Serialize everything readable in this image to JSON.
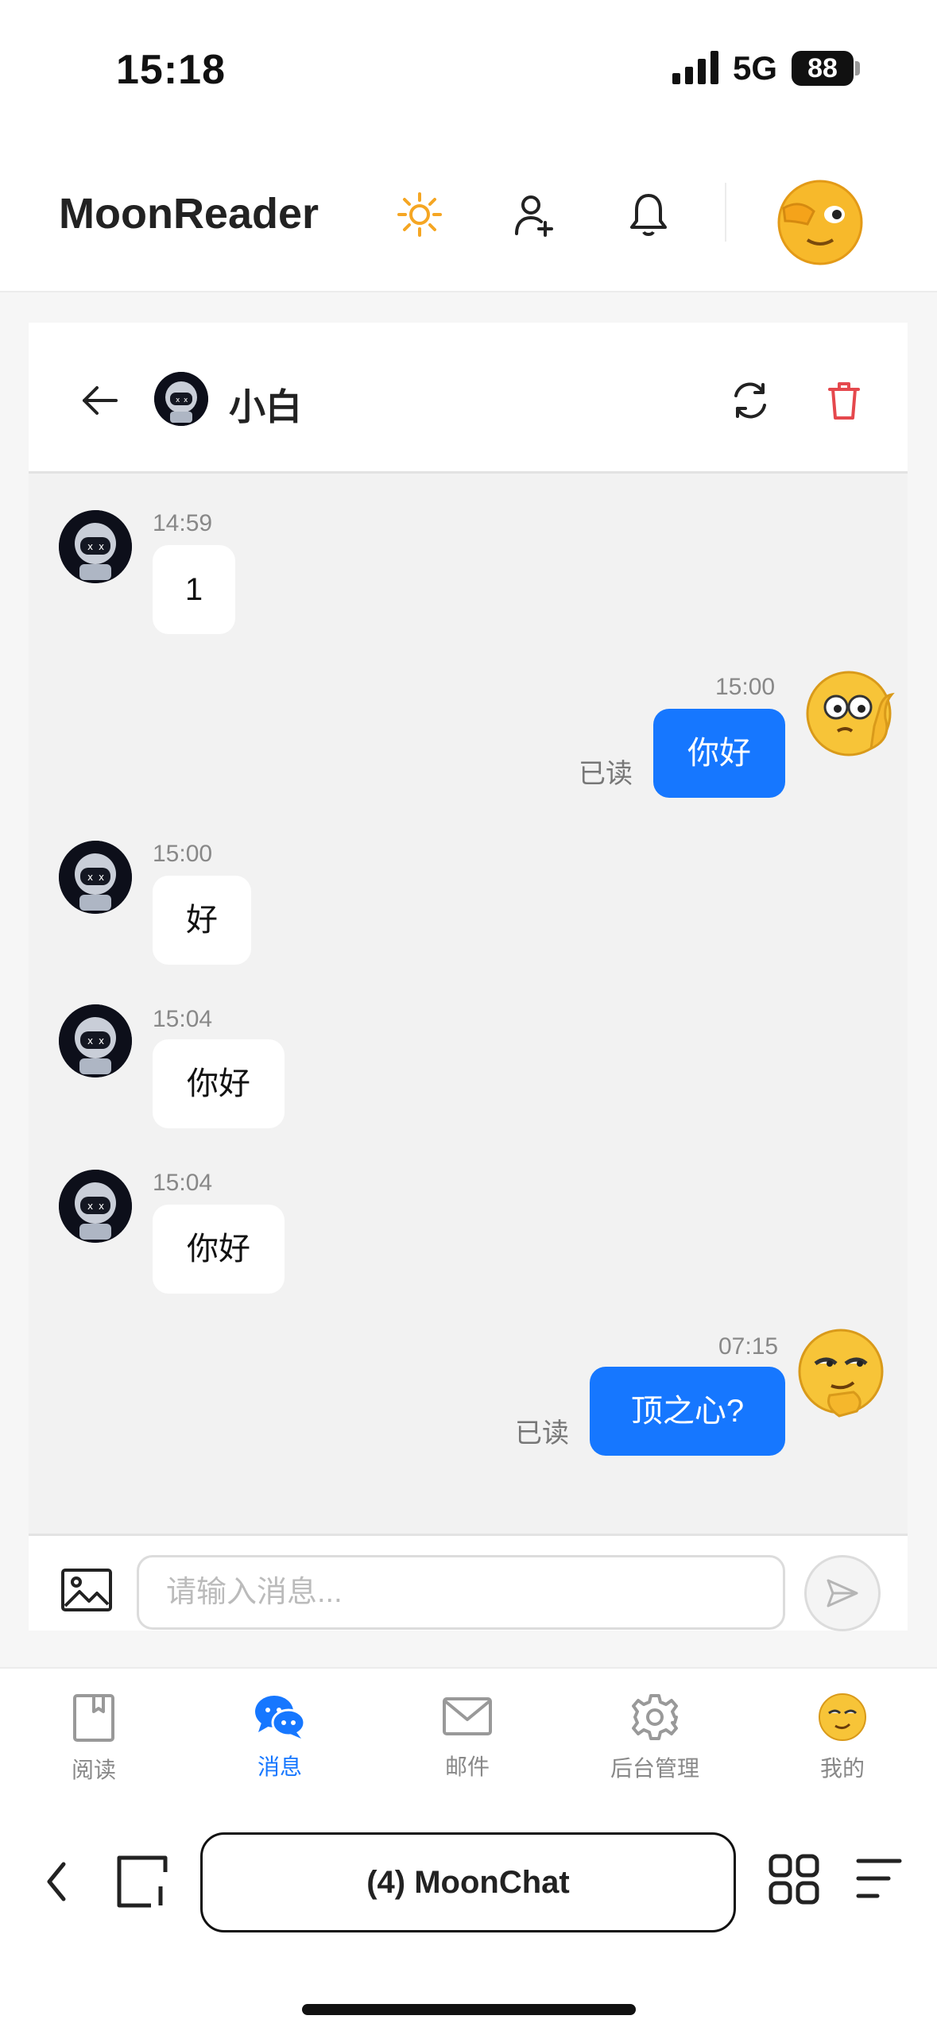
{
  "status": {
    "time": "15:18",
    "network": "5G",
    "battery": "88"
  },
  "header": {
    "app_title": "MoonReader"
  },
  "chat": {
    "name": "小白",
    "messages": [
      {
        "side": "in",
        "time": "14:59",
        "text": "1"
      },
      {
        "side": "out",
        "time": "15:00",
        "text": "你好",
        "status": "已读"
      },
      {
        "side": "in",
        "time": "15:00",
        "text": "好"
      },
      {
        "side": "in",
        "time": "15:04",
        "text": "你好"
      },
      {
        "side": "in",
        "time": "15:04",
        "text": "你好"
      },
      {
        "side": "out",
        "time": "07:15",
        "text": "顶之心?",
        "status": "已读"
      }
    ],
    "input_placeholder": "请输入消息..."
  },
  "nav": {
    "items": [
      {
        "label": "阅读",
        "icon": "book-icon",
        "active": false
      },
      {
        "label": "消息",
        "icon": "chat-icon",
        "active": true
      },
      {
        "label": "邮件",
        "icon": "mail-icon",
        "active": false
      },
      {
        "label": "后台管理",
        "icon": "gear-icon",
        "active": false
      },
      {
        "label": "我的",
        "icon": "avatar-icon",
        "active": false
      }
    ]
  },
  "browser": {
    "tab_title": "(4) MoonChat"
  },
  "colors": {
    "accent": "#1677ff",
    "danger": "#e5484d",
    "sun": "#f5a623"
  }
}
